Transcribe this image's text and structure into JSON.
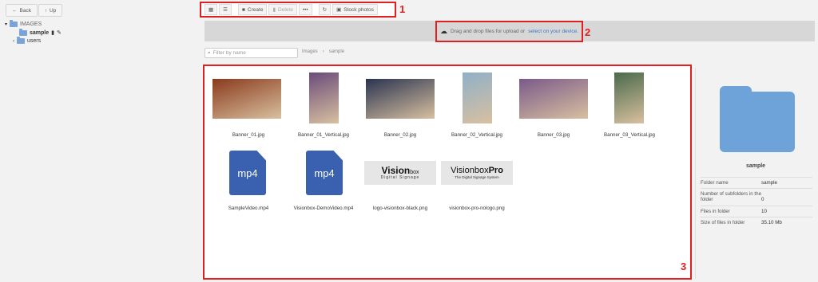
{
  "nav": {
    "back_label": "Back",
    "up_label": "Up"
  },
  "tree": {
    "root_label": "IMAGES",
    "items": [
      {
        "label": "sample",
        "selected": true
      },
      {
        "label": "users",
        "selected": false
      }
    ]
  },
  "toolbar": {
    "grid_icon": "grid-view-icon",
    "list_icon": "list-view-icon",
    "create_label": "Create",
    "delete_label": "Delete",
    "more_label": "•••",
    "refresh_icon": "refresh-icon",
    "stock_label": "Stock photos"
  },
  "upload": {
    "text": "Drag and drop files for upload or",
    "link": "select on your device."
  },
  "filter": {
    "placeholder": "Filter by name"
  },
  "breadcrumb": {
    "root": "Images",
    "current": "sample"
  },
  "callouts": {
    "one": "1",
    "two": "2",
    "three": "3"
  },
  "files": [
    {
      "name": "Banner_01.jpg",
      "color": "#8a3a1c"
    },
    {
      "name": "Banner_01_Vertical.jpg",
      "color": "#6a4c7a"
    },
    {
      "name": "Banner_02.jpg",
      "color": "#2a3450"
    },
    {
      "name": "Banner_02_Vertical.jpg",
      "color": "#8fb0c8"
    },
    {
      "name": "Banner_03.jpg",
      "color": "#7a5a8a"
    },
    {
      "name": "Banner_03_Vertical.jpg",
      "color": "#4a6a4a"
    },
    {
      "name": "SampleVideo.mp4",
      "type": "mp4"
    },
    {
      "name": "Visionbox-DemoVideo.mp4",
      "type": "mp4"
    },
    {
      "name": "logo-visionbox-black.png",
      "logo_main": "Vision",
      "logo_sub": "box",
      "logo_tag": "Digital Signage"
    },
    {
      "name": "visionbox-pro-nologo.png",
      "logo_main": "Visionbox",
      "logo_sub": "Pro",
      "logo_tag": "The Digital Signage System"
    }
  ],
  "mp4_label": "mp4",
  "details": {
    "folder_name": "sample",
    "rows": [
      {
        "key": "Folder name",
        "value": "sample"
      },
      {
        "key": "Number of subfolders in the folder",
        "value": "0"
      },
      {
        "key": "Files in folder",
        "value": "10"
      },
      {
        "key": "Size of files in folder",
        "value": "35.10 Mb"
      }
    ]
  }
}
